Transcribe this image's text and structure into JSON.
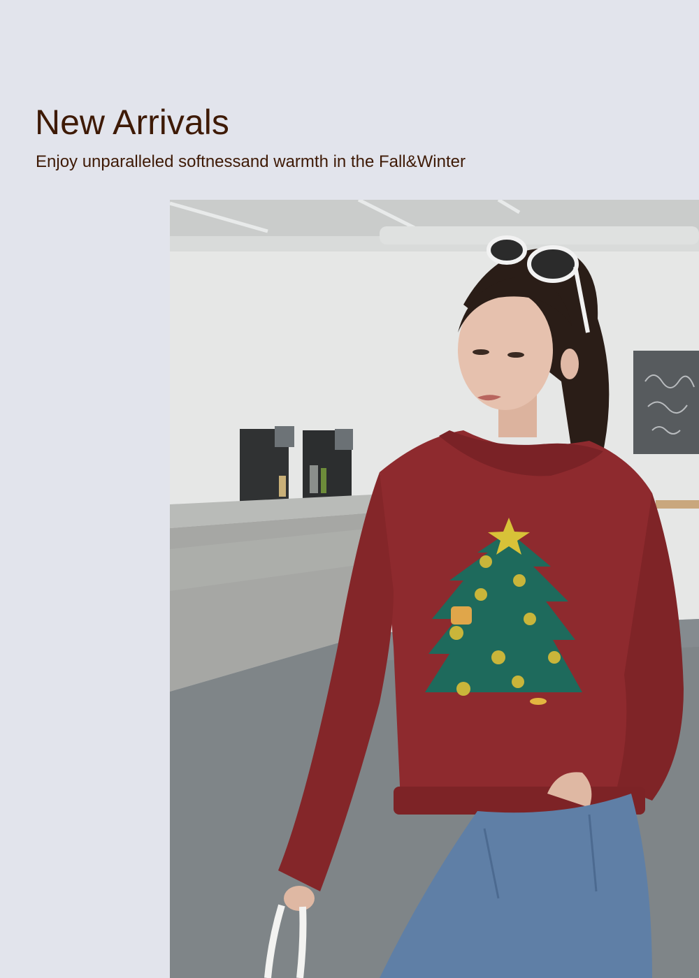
{
  "banner": {
    "title": "New Arrivals",
    "subtitle": "Enjoy unparalleled softnessand warmth in the Fall&Winter"
  },
  "photo": {
    "subject": "woman-in-christmas-tree-sweater",
    "colors": {
      "background": "#e2e4ec",
      "title_text": "#3e1a06",
      "sweater": "#8e2a2e",
      "tree": "#1e6a5c",
      "star": "#d8c238",
      "jeans": "#5f7fa6"
    }
  }
}
